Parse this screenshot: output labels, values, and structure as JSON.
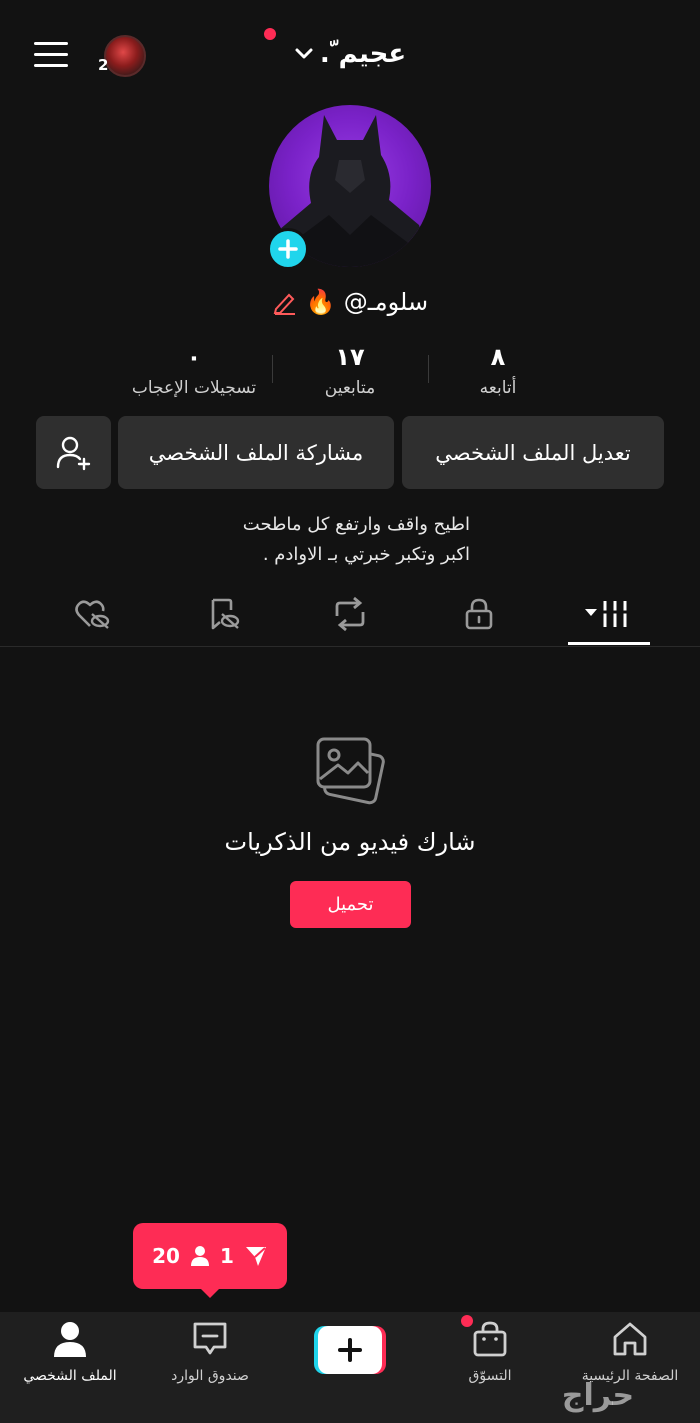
{
  "header": {
    "title": "عجيم ّ.",
    "mini_avatar_badge": "2"
  },
  "profile": {
    "username": "@سلومـ",
    "emoji": "🔥"
  },
  "stats": [
    {
      "value": "٨",
      "label": "أتابعه"
    },
    {
      "value": "١٧",
      "label": "متابعين"
    },
    {
      "value": "٠",
      "label": "تسجيلات الإعجاب"
    }
  ],
  "buttons": {
    "edit_profile": "تعديل الملف الشخصي",
    "share_profile": "مشاركة الملف الشخصي"
  },
  "bio": {
    "line1": "اطيح واقف وارتفع كل ماطحت",
    "line2": "اكبر وتكبر خبرتي بـ الاوادم ."
  },
  "tabs": [
    {
      "name": "videos",
      "icon": "grid-icon"
    },
    {
      "name": "private",
      "icon": "lock-icon"
    },
    {
      "name": "reposts",
      "icon": "repost-icon"
    },
    {
      "name": "favorites",
      "icon": "bookmark-hidden-icon"
    },
    {
      "name": "liked",
      "icon": "heart-hidden-icon"
    }
  ],
  "empty_state": {
    "title": "شارك فيديو من الذكريات",
    "upload_label": "تحميل"
  },
  "notification": {
    "followers_count": "20",
    "messages_count": "1"
  },
  "bottom_nav": {
    "home": "الصفحة الرئيسية",
    "shop": "التسوّق",
    "inbox": "صندوق الوارد",
    "profile": "الملف الشخصي"
  },
  "watermark": "حراج",
  "colors": {
    "accent": "#fe2c55",
    "cyan": "#20d5ec",
    "background": "#121212",
    "button_bg": "#2f2f2f"
  }
}
